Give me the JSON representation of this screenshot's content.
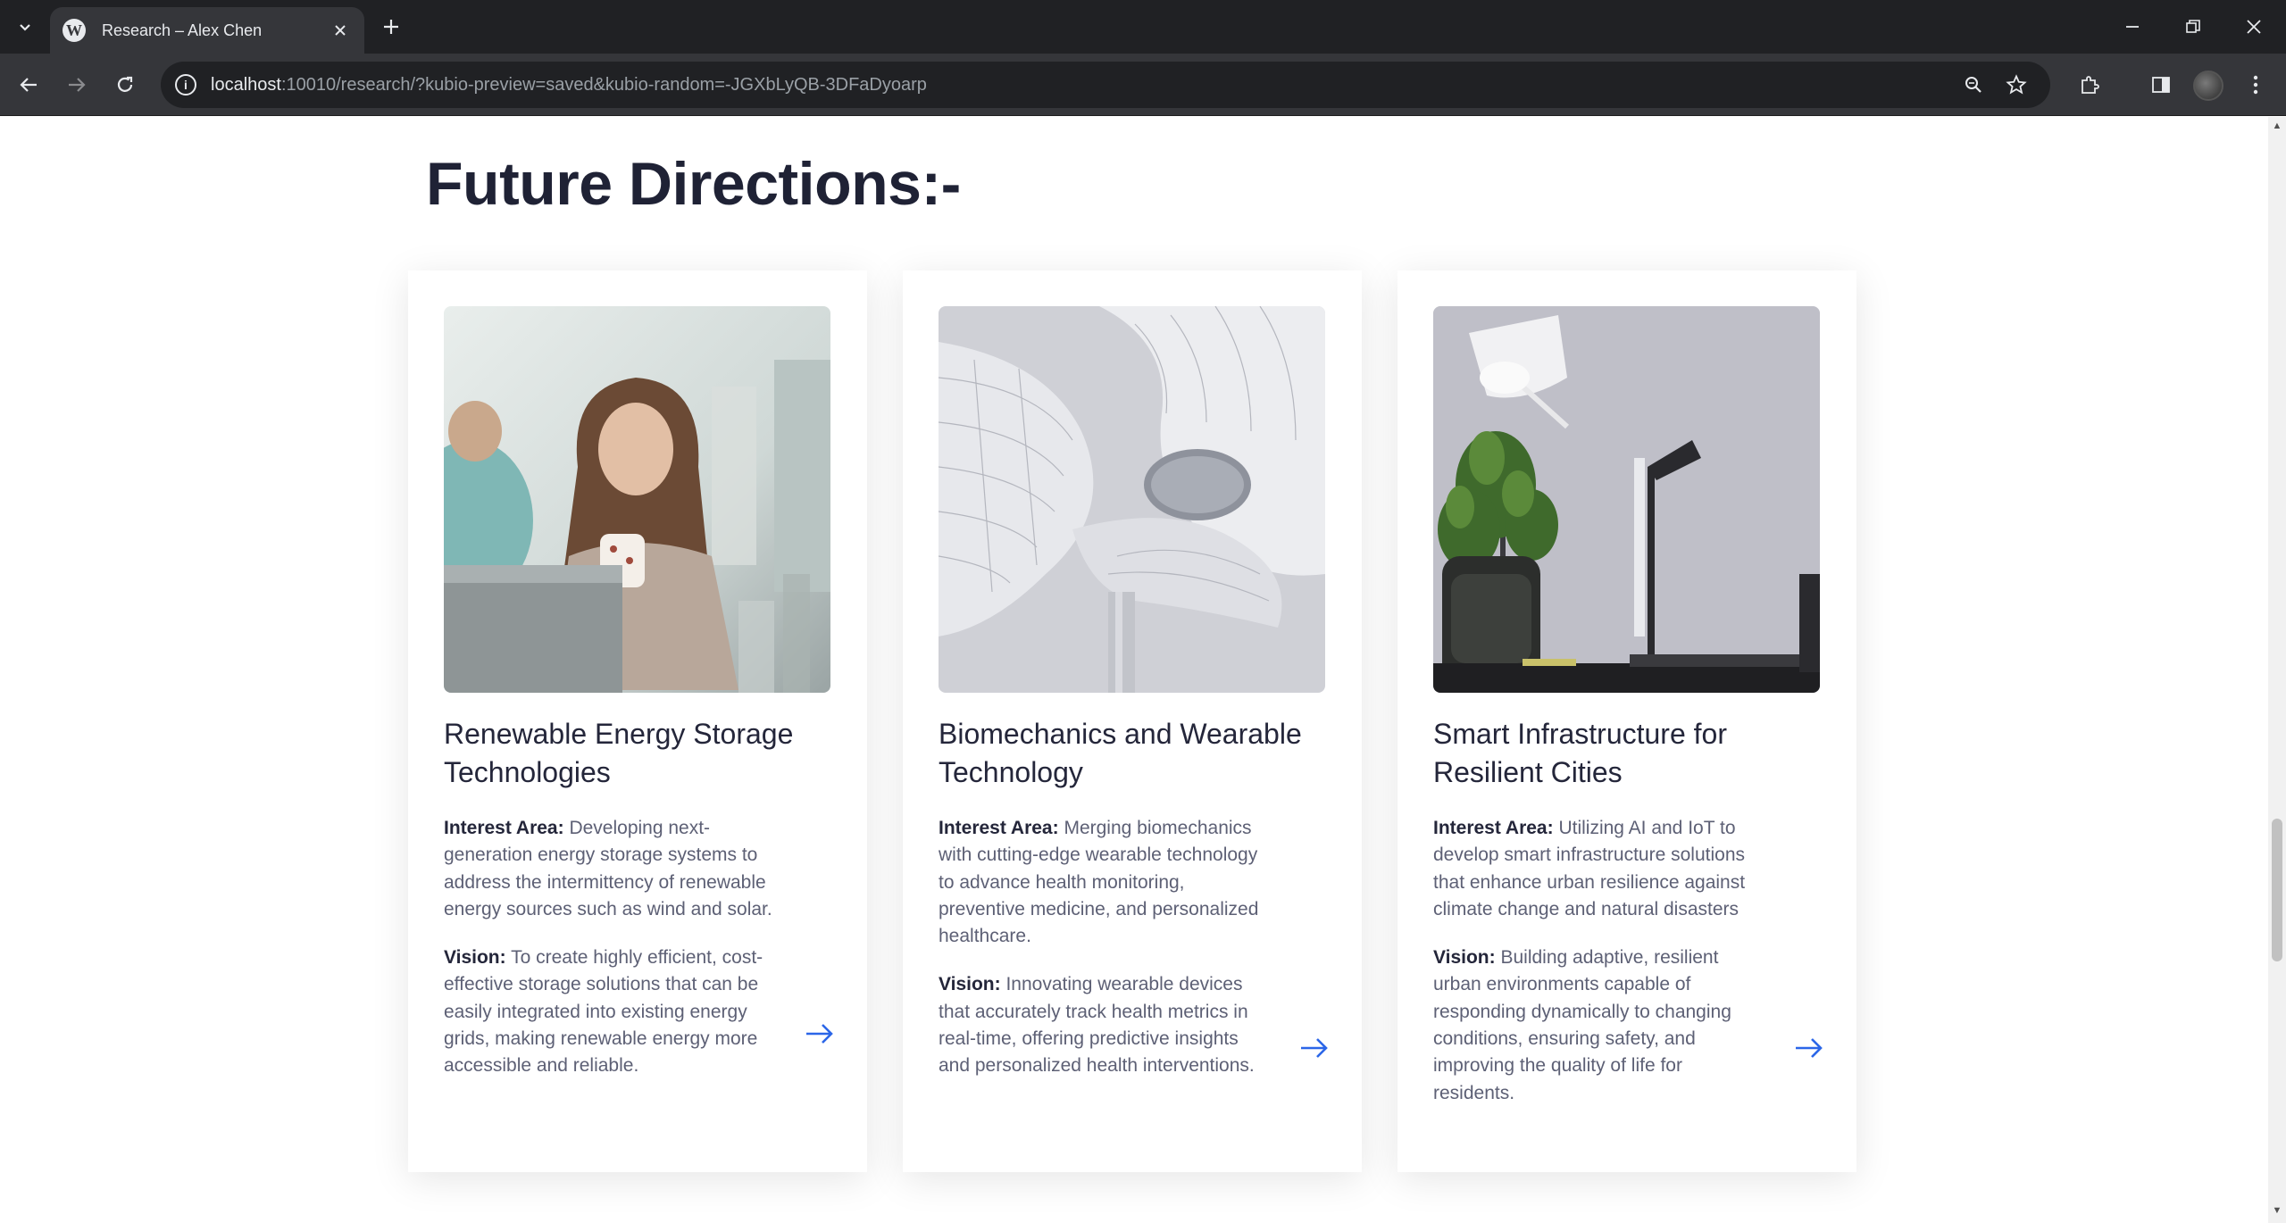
{
  "browser": {
    "tab_title": "Research – Alex Chen",
    "favicon_letter": "W",
    "url_host": "localhost",
    "url_rest": ":10010/research/?kubio-preview=saved&kubio-random=-JGXbLyQB-3DFaDyoarp",
    "icons": {
      "tab_search": "chevron-down-icon",
      "new_tab": "plus-icon",
      "back": "arrow-left-icon",
      "forward": "arrow-right-icon",
      "reload": "reload-icon",
      "site_info": "info-icon",
      "zoom": "magnifier-icon",
      "bookmark": "star-icon",
      "extensions": "puzzle-icon",
      "side_panel": "side-panel-icon",
      "menu": "kebab-menu-icon"
    }
  },
  "page": {
    "section_title": "Future Directions:-",
    "accent_color": "#2b66e8",
    "cards": [
      {
        "title": "Renewable Energy Storage Technologies",
        "interest_label": "Interest Area:",
        "interest_text": "Developing next-generation energy storage systems to address the intermittency of renewable energy sources such as wind and solar.",
        "vision_label": "Vision:",
        "vision_text": "To create highly efficient, cost-effective storage solutions that can be easily integrated into existing energy grids, making renewable energy more accessible and reliable.",
        "image": "woman-with-mug-at-laptop-photo"
      },
      {
        "title": "Biomechanics and Wearable Technology",
        "interest_label": "Interest Area:",
        "interest_text": "Merging biomechanics with cutting-edge wearable technology to advance health monitoring, preventive medicine, and personalized healthcare.",
        "vision_label": "Vision:",
        "vision_text": "Innovating wearable devices that accurately track health metrics in real-time, offering predictive insights and personalized health interventions.",
        "image": "curved-white-architecture-photo"
      },
      {
        "title": "Smart Infrastructure for Resilient Cities",
        "interest_label": "Interest Area:",
        "interest_text": "Utilizing AI and IoT to develop smart infrastructure solutions that enhance urban resilience against climate change and natural disasters",
        "vision_label": "Vision:",
        "vision_text": "Building adaptive, resilient urban environments capable of responding dynamically to changing conditions, ensuring safety, and improving the quality of life for residents.",
        "image": "desk-lamp-plant-laptop-photo"
      }
    ]
  }
}
